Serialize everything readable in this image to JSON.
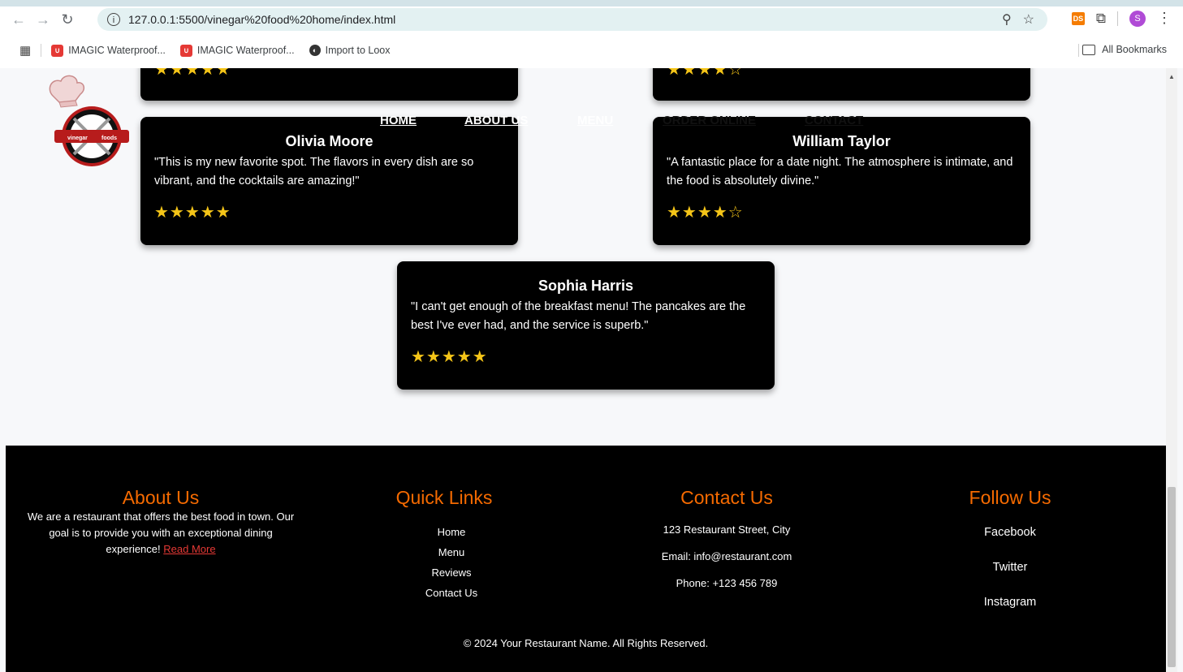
{
  "browser": {
    "url": "127.0.0.1:5500/vinegar%20food%20home/index.html",
    "bookmarks": [
      {
        "label": "IMAGIC Waterproof..."
      },
      {
        "label": "IMAGIC Waterproof..."
      },
      {
        "label": "Import to Loox"
      }
    ],
    "all_bookmarks": "All Bookmarks",
    "profile_initial": "S",
    "ext_ds": "DS"
  },
  "logo": {
    "left_word": "vinegar",
    "right_word": "foods"
  },
  "nav": {
    "home": "HOME",
    "about": "ABOUT US",
    "menu": "MENU",
    "order": "ORDER ONLINE",
    "contact": "CONTACT"
  },
  "reviews": {
    "top_left_stars": "★★★★★",
    "top_right_stars": "★★★★☆",
    "olivia": {
      "name": "Olivia Moore",
      "text": "\"This is my new favorite spot. The flavors in every dish are so vibrant, and the cocktails are amazing!\"",
      "stars": "★★★★★"
    },
    "william": {
      "name": "William Taylor",
      "text": "\"A fantastic place for a date night. The atmosphere is intimate, and the food is absolutely divine.\"",
      "stars": "★★★★☆"
    },
    "sophia": {
      "name": "Sophia Harris",
      "text": "\"I can't get enough of the breakfast menu! The pancakes are the best I've ever had, and the service is superb.\"",
      "stars": "★★★★★"
    }
  },
  "footer": {
    "about": {
      "title": "About Us",
      "text": "We are a restaurant that offers the best food in town. Our goal is to provide you with an exceptional dining experience!",
      "read_more": "Read More"
    },
    "quick_links": {
      "title": "Quick Links",
      "items": [
        "Home",
        "Menu",
        "Reviews",
        "Contact Us"
      ]
    },
    "contact": {
      "title": "Contact Us",
      "address": "123 Restaurant Street, City",
      "email": "Email: info@restaurant.com",
      "phone": "Phone: +123 456 789"
    },
    "follow": {
      "title": "Follow Us",
      "items": [
        "Facebook",
        "Twitter",
        "Instagram"
      ]
    },
    "copyright": "© 2024 Your Restaurant Name. All Rights Reserved."
  },
  "colors": {
    "accent": "#f56a00",
    "star": "#f5c518",
    "link_red": "#e53935",
    "card": "#000000"
  }
}
